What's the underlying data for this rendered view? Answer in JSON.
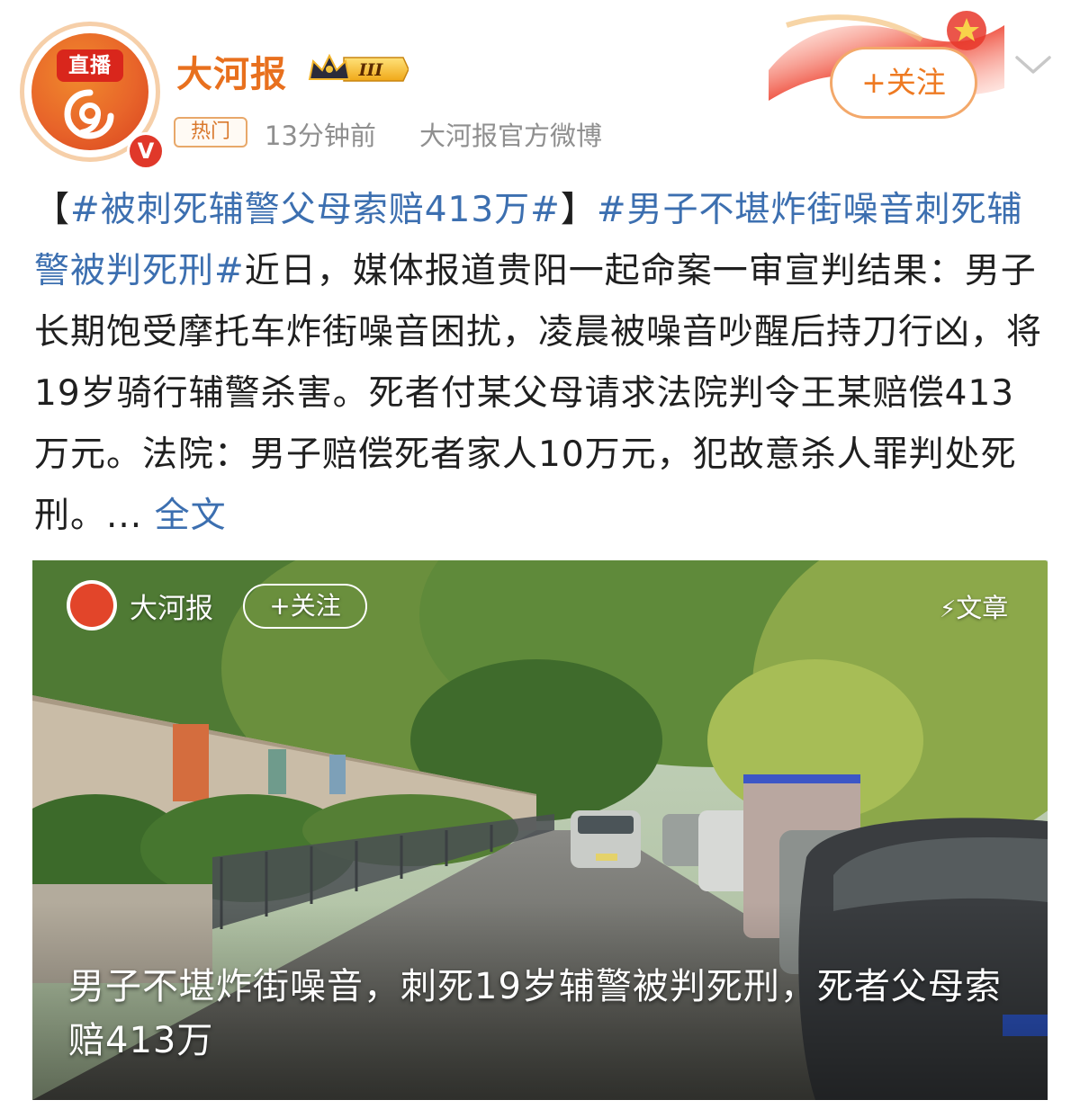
{
  "header": {
    "live_badge": "直播",
    "verify_badge": "V",
    "account_name": "大河报",
    "level_badge": "III",
    "hot_tag": "热门",
    "time": "13分钟前",
    "source": "大河报官方微博",
    "follow_label": "+关注"
  },
  "post": {
    "bracket_open": "【",
    "topic1": "#被刺死辅警父母索赔413万#",
    "bracket_close": "】",
    "topic2": "#男子不堪炸街噪音刺死辅警被判死刑#",
    "body": "近日，媒体报道贵阳一起命案一审宣判结果：男子长期饱受摩托车炸街噪音困扰，凌晨被噪音吵醒后持刀行凶，将19岁骑行辅警杀害。死者付某父母请求法院判令王某赔偿413万元。法院：男子赔偿死者家人10万元，犯故意杀人罪判处死刑。... ",
    "more_label": "全文"
  },
  "card": {
    "account_name": "大河报",
    "follow_label": "+关注",
    "tag_label": "文章",
    "caption": "男子不堪炸街噪音，刺死19岁辅警被判死刑，死者父母索赔413万"
  },
  "colors": {
    "accent_orange": "#e8701e",
    "topic_blue": "#3c6fb0",
    "meta_gray": "#8f8f8f"
  },
  "icons": {
    "verify": "verified-v-icon",
    "crown": "crown-level-icon",
    "chevron": "chevron-down-icon",
    "bolt": "lightning-icon"
  }
}
